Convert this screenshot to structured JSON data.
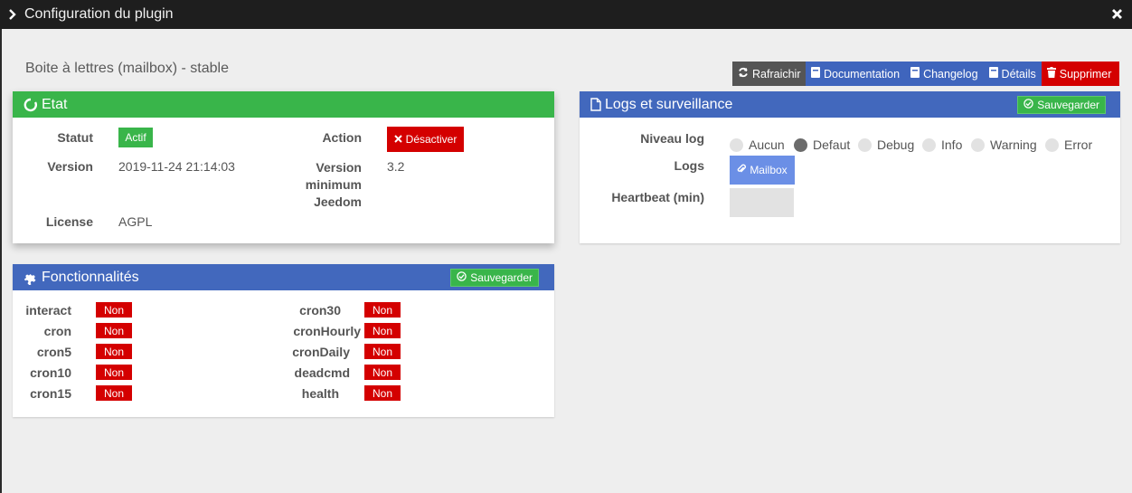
{
  "window": {
    "title": "Configuration du plugin"
  },
  "plugin": {
    "name": "Boite à lettres (mailbox) - stable"
  },
  "toolbar": {
    "refresh": "Rafraichir",
    "documentation": "Documentation",
    "changelog": "Changelog",
    "details": "Détails",
    "delete": "Supprimer"
  },
  "etat": {
    "title": "Etat",
    "statut_label": "Statut",
    "statut_value": "Actif",
    "action_label": "Action",
    "action_button": "Désactiver",
    "version_label": "Version",
    "version_value": "2019-11-24 21:14:03",
    "min_version_label_1": "Version",
    "min_version_label_2": "minimum",
    "min_version_label_3": "Jeedom",
    "min_version_value": "3.2",
    "license_label": "License",
    "license_value": "AGPL"
  },
  "logs": {
    "title": "Logs et surveillance",
    "save_label": "Sauvegarder",
    "niveau_label": "Niveau log",
    "levels": [
      "Aucun",
      "Defaut",
      "Debug",
      "Info",
      "Warning",
      "Error"
    ],
    "selected_level": "Defaut",
    "logs_label": "Logs",
    "mailbox_button": "Mailbox",
    "heartbeat_label": "Heartbeat (min)",
    "heartbeat_value": ""
  },
  "fonctionnalites": {
    "title": "Fonctionnalités",
    "save_label": "Sauvegarder",
    "left": [
      {
        "name": "interact",
        "value": "Non"
      },
      {
        "name": "cron",
        "value": "Non"
      },
      {
        "name": "cron5",
        "value": "Non"
      },
      {
        "name": "cron10",
        "value": "Non"
      },
      {
        "name": "cron15",
        "value": "Non"
      }
    ],
    "right": [
      {
        "name": "cron30",
        "value": "Non"
      },
      {
        "name": "cronHourly",
        "value": "Non"
      },
      {
        "name": "cronDaily",
        "value": "Non"
      },
      {
        "name": "deadcmd",
        "value": "Non"
      },
      {
        "name": "health",
        "value": "Non"
      }
    ]
  },
  "colors": {
    "green": "#39b54a",
    "blue": "#4268bd",
    "red": "#d40000",
    "dark": "#1e1e1e"
  },
  "icons": [
    "chevron-right-icon",
    "close-icon",
    "refresh-icon",
    "book-icon",
    "trash-icon",
    "circle-notch-icon",
    "file-icon",
    "check-circle-icon",
    "times-icon",
    "paperclip-icon",
    "puzzle-icon"
  ]
}
